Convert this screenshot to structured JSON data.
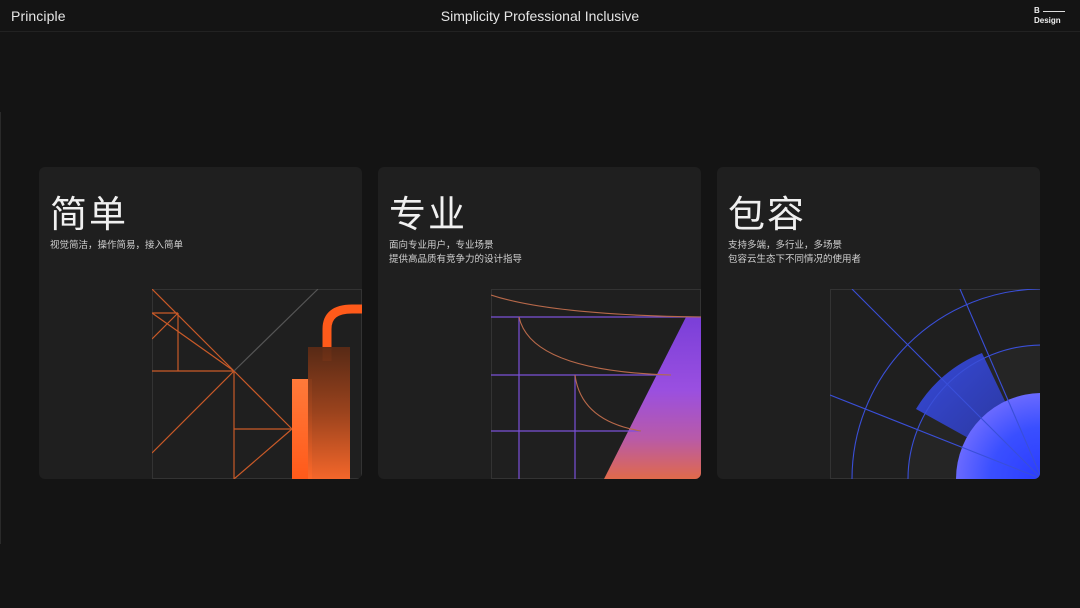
{
  "header": {
    "left_label": "Principle",
    "center_title": "Simplicity Professional Inclusive",
    "logo": {
      "top": "B",
      "bottom": "Design"
    }
  },
  "cards": [
    {
      "title": "简单",
      "desc_lines": [
        "视觉简洁，操作简易，接入简单"
      ],
      "accent": "#ff6a2b",
      "illustration": "orange-geometric-lines"
    },
    {
      "title": "专业",
      "desc_lines": [
        "面向专业用户，专业场景",
        "提供高品质有竞争力的设计指导"
      ],
      "accent": "#8a4fe0",
      "illustration": "purple-gradient-triangle"
    },
    {
      "title": "包容",
      "desc_lines": [
        "支持多端，多行业，多场景",
        "包容云生态下不同情况的使用者"
      ],
      "accent": "#3447ff",
      "illustration": "blue-radial-fan"
    }
  ],
  "colors": {
    "background": "#141414",
    "card": "#1f1f1f",
    "orange": "#ff6a2b",
    "purple": "#8a4fe0",
    "blue": "#3447ff"
  }
}
